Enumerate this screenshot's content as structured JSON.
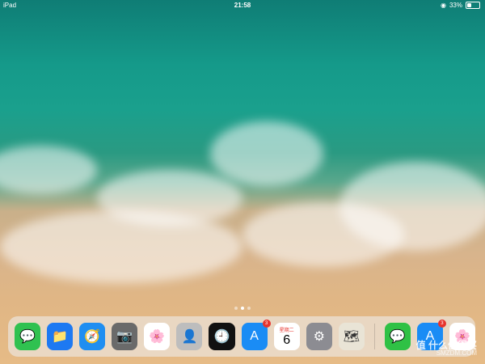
{
  "status_bar": {
    "device": "iPad",
    "time": "21:58",
    "battery_percent": "33%",
    "battery_level": 0.33,
    "orientation_lock_icon": "orientation-lock-icon"
  },
  "home": {
    "page_count": 3,
    "active_page": 2
  },
  "dock": {
    "apps": [
      {
        "name": "Messages",
        "icon": "messages-icon",
        "color": "#30c150"
      },
      {
        "name": "Files",
        "icon": "files-icon",
        "color": "#1d79f2"
      },
      {
        "name": "Safari",
        "icon": "safari-icon",
        "color": "#1f8ef1"
      },
      {
        "name": "Camera",
        "icon": "camera-icon",
        "color": "#6a6a6a"
      },
      {
        "name": "Photos",
        "icon": "photos-icon",
        "color": "#ffffff"
      },
      {
        "name": "Contacts",
        "icon": "contacts-icon",
        "color": "#bdbdbd"
      },
      {
        "name": "Clock",
        "icon": "clock-icon",
        "color": "#111111"
      },
      {
        "name": "App Store",
        "icon": "app-store-icon",
        "color": "#1a8cf5",
        "badge": "3"
      },
      {
        "name": "Calendar",
        "icon": "calendar-icon",
        "color": "#ffffff",
        "weekday": "星期二",
        "day": "6"
      },
      {
        "name": "Settings",
        "icon": "settings-icon",
        "color": "#8c8c92"
      },
      {
        "name": "Maps",
        "icon": "maps-icon",
        "color": "#e9e4d6"
      }
    ],
    "recent_apps": [
      {
        "name": "WeChat",
        "icon": "wechat-icon",
        "color": "#2fc145"
      },
      {
        "name": "App Store",
        "icon": "app-store-icon",
        "color": "#1a8cf5",
        "badge": "3"
      },
      {
        "name": "Photos",
        "icon": "photos-icon",
        "color": "#ffffff"
      }
    ]
  },
  "watermark": {
    "text": "值 什么值得买",
    "sub": "SMZDM.COM"
  }
}
